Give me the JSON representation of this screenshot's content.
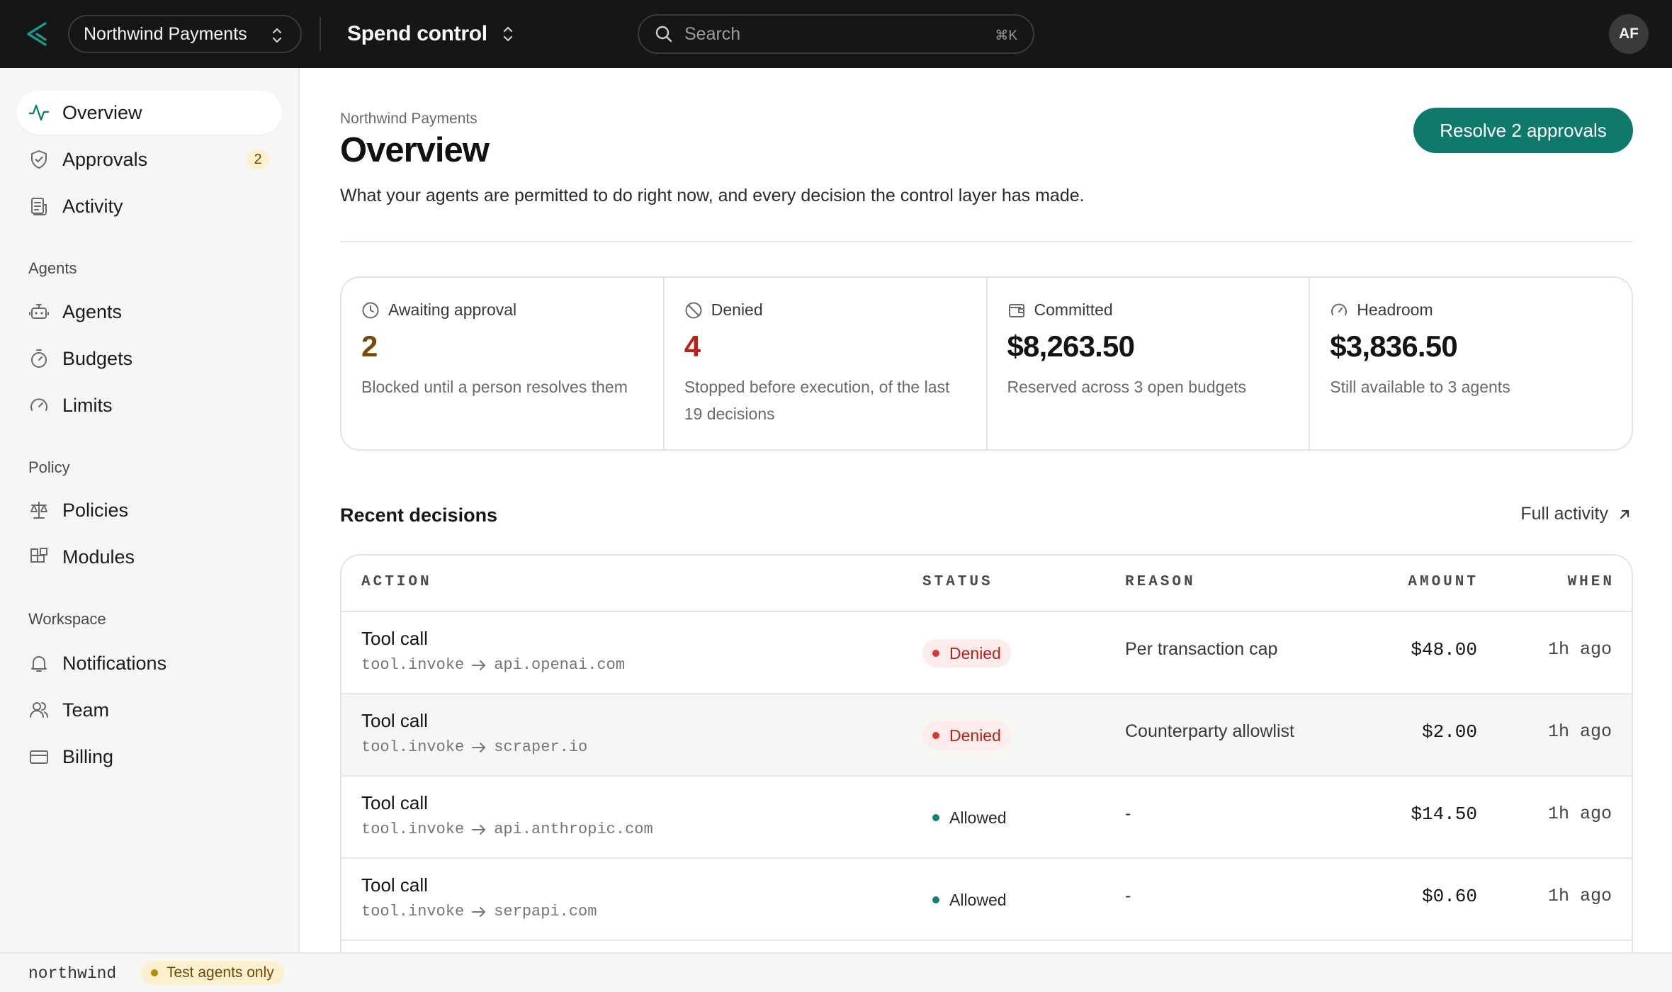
{
  "topbar": {
    "org_name": "Northwind Payments",
    "product_name": "Spend control",
    "search_placeholder": "Search",
    "search_shortcut": "⌘K",
    "user_initials": "AF"
  },
  "sidebar": {
    "primary": [
      {
        "label": "Overview",
        "icon": "activity-icon",
        "active": true
      },
      {
        "label": "Approvals",
        "icon": "shield-check-icon",
        "badge": "2"
      },
      {
        "label": "Activity",
        "icon": "receipt-icon"
      }
    ],
    "sections": [
      {
        "title": "Agents",
        "items": [
          {
            "label": "Agents",
            "icon": "bot-icon"
          },
          {
            "label": "Budgets",
            "icon": "timer-icon"
          },
          {
            "label": "Limits",
            "icon": "gauge-icon"
          }
        ]
      },
      {
        "title": "Policy",
        "items": [
          {
            "label": "Policies",
            "icon": "scale-icon"
          },
          {
            "label": "Modules",
            "icon": "blocks-icon"
          }
        ]
      },
      {
        "title": "Workspace",
        "items": [
          {
            "label": "Notifications",
            "icon": "bell-icon"
          },
          {
            "label": "Team",
            "icon": "users-icon"
          },
          {
            "label": "Billing",
            "icon": "credit-card-icon"
          }
        ]
      }
    ]
  },
  "statusbar": {
    "workspace_slug": "northwind",
    "env_label": "Test agents only"
  },
  "main": {
    "breadcrumb": "Northwind Payments",
    "title": "Overview",
    "subtitle": "What your agents are permitted to do right now, and every decision the control layer has made.",
    "primary_action": "Resolve 2 approvals",
    "stats": [
      {
        "label": "Awaiting approval",
        "value": "2",
        "note": "Blocked until a person resolves them",
        "icon": "clock-icon",
        "value_color": "#7a4a0a"
      },
      {
        "label": "Denied",
        "value": "4",
        "note": "Stopped before execution, of the last 19 decisions",
        "icon": "ban-icon",
        "value_color": "#b3241a"
      },
      {
        "label": "Committed",
        "value": "$8,263.50",
        "note": "Reserved across 3 open budgets",
        "icon": "wallet-icon",
        "value_color": "#111111"
      },
      {
        "label": "Headroom",
        "value": "$3,836.50",
        "note": "Still available to 3 agents",
        "icon": "gauge-icon",
        "value_color": "#111111"
      }
    ],
    "recent": {
      "title": "Recent decisions",
      "link_label": "Full activity",
      "columns": [
        "ACTION",
        "STATUS",
        "REASON",
        "AMOUNT",
        "WHEN"
      ],
      "rows": [
        {
          "title": "Tool call",
          "method": "tool.invoke",
          "target": "api.openai.com",
          "status": "Denied",
          "reason": "Per transaction cap",
          "amount": "$48.00",
          "when": "1h ago"
        },
        {
          "title": "Tool call",
          "method": "tool.invoke",
          "target": "scraper.io",
          "status": "Denied",
          "reason": "Counterparty allowlist",
          "amount": "$2.00",
          "when": "1h ago"
        },
        {
          "title": "Tool call",
          "method": "tool.invoke",
          "target": "api.anthropic.com",
          "status": "Allowed",
          "reason": "-",
          "amount": "$14.50",
          "when": "1h ago"
        },
        {
          "title": "Tool call",
          "method": "tool.invoke",
          "target": "serpapi.com",
          "status": "Allowed",
          "reason": "-",
          "amount": "$0.60",
          "when": "1h ago"
        }
      ]
    }
  },
  "colors": {
    "brand": "#0f7a6c",
    "topbar": "#161616",
    "denied": "#b3241a",
    "allowed_dot": "#14806f",
    "pending": "#7a4a0a"
  }
}
